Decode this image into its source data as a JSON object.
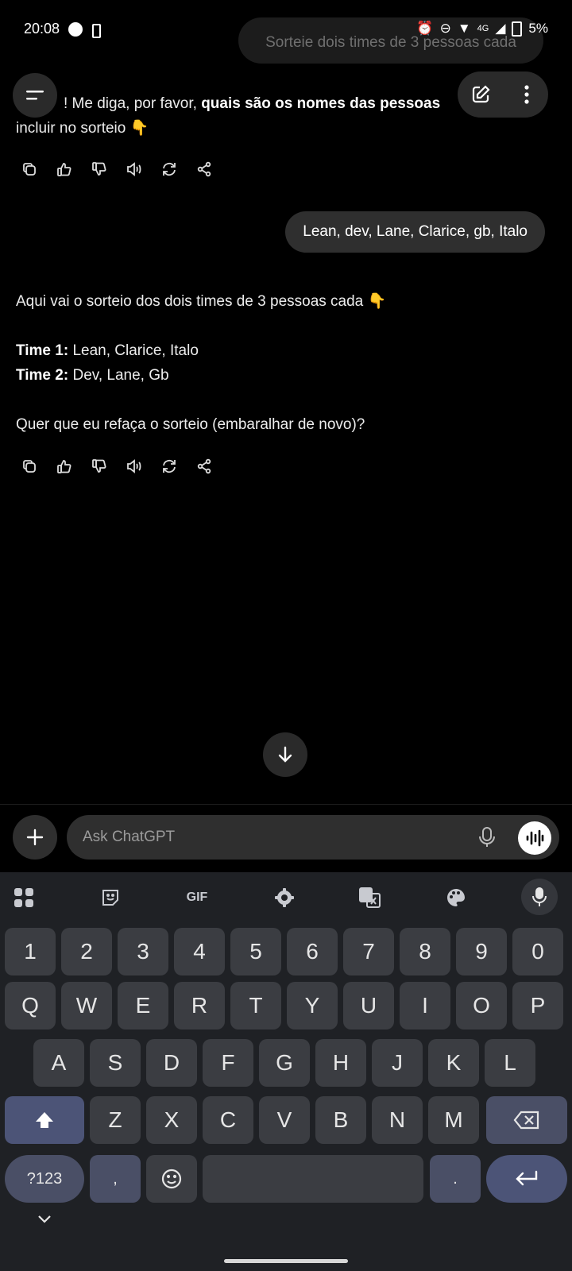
{
  "status_bar": {
    "time": "20:08",
    "network": "4G",
    "battery": "5%"
  },
  "header": {
    "chat_title": "Sorteie dois times de 3 pessoas cada"
  },
  "messages": {
    "assistant_1": {
      "line1_start": "! Me diga, por favor, ",
      "line1_bold": "quais são os nomes das pessoas",
      "line2": "incluir no sorteio 👇"
    },
    "user_1": {
      "text": "Lean, dev, Lane, Clarice, gb, Italo"
    },
    "assistant_2": {
      "intro": "Aqui vai o sorteio dos dois times de 3 pessoas cada 👇",
      "team1_label": "Time 1:",
      "team1_members": " Lean, Clarice, Italo",
      "team2_label": "Time 2:",
      "team2_members": " Dev, Lane, Gb",
      "question": "Quer que eu refaça o sorteio (embaralhar de novo)?"
    }
  },
  "composer": {
    "placeholder": "Ask ChatGPT"
  },
  "keyboard": {
    "toolbar_gif": "GIF",
    "row_numbers": [
      "1",
      "2",
      "3",
      "4",
      "5",
      "6",
      "7",
      "8",
      "9",
      "0"
    ],
    "row_q": [
      "Q",
      "W",
      "E",
      "R",
      "T",
      "Y",
      "U",
      "I",
      "O",
      "P"
    ],
    "row_a": [
      "A",
      "S",
      "D",
      "F",
      "G",
      "H",
      "J",
      "K",
      "L"
    ],
    "row_z": [
      "Z",
      "X",
      "C",
      "V",
      "B",
      "N",
      "M"
    ],
    "symbols_key": "?123",
    "comma_key": ",",
    "period_key": "."
  },
  "colors": {
    "background": "#000000",
    "keyboard_bg": "#1f2125",
    "bubble": "#2f2f2f",
    "accent_key": "#4c5477"
  }
}
